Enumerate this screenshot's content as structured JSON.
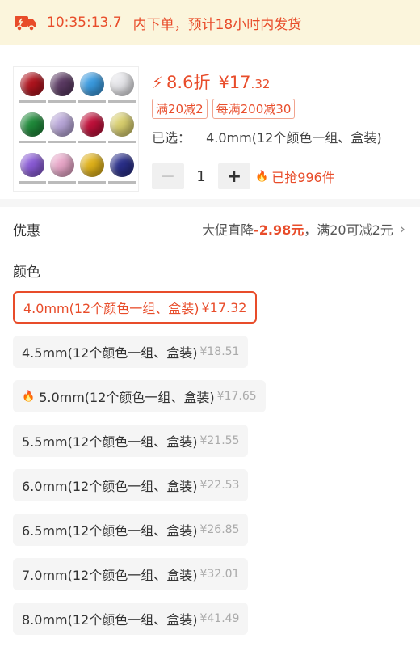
{
  "banner": {
    "icon": "delivery-truck-icon",
    "time": "10:35:13.7",
    "text": "内下单，预计18小时内发货",
    "color": "#e84c2a",
    "bg": "#fbf5dc"
  },
  "product": {
    "thumbnail": "gemstone-color-chart",
    "discount": "8.6折",
    "price_int": "¥17",
    "price_dec": ".32",
    "coupons": [
      "满20减2",
      "每满200减30"
    ],
    "selected_label": "已选：",
    "selected_value": "4.0mm(12个颜色一组、盒装)",
    "quantity": "1",
    "sold": "已抢996件"
  },
  "promo": {
    "label": "优惠",
    "prefix": "大促直降",
    "amount": "-2.98元",
    "suffix": "，满20可减2元"
  },
  "options_title": "颜色",
  "options": [
    {
      "label": "4.0mm(12个颜色一组、盒装)",
      "price": "¥17.32",
      "selected": true,
      "hot": false
    },
    {
      "label": "4.5mm(12个颜色一组、盒装)",
      "price": "¥18.51",
      "selected": false,
      "hot": false
    },
    {
      "label": "5.0mm(12个颜色一组、盒装)",
      "price": "¥17.65",
      "selected": false,
      "hot": true
    },
    {
      "label": "5.5mm(12个颜色一组、盒装)",
      "price": "¥21.55",
      "selected": false,
      "hot": false
    },
    {
      "label": "6.0mm(12个颜色一组、盒装)",
      "price": "¥22.53",
      "selected": false,
      "hot": false
    },
    {
      "label": "6.5mm(12个颜色一组、盒装)",
      "price": "¥26.85",
      "selected": false,
      "hot": false
    },
    {
      "label": "7.0mm(12个颜色一组、盒装)",
      "price": "¥32.01",
      "selected": false,
      "hot": false
    },
    {
      "label": "8.0mm(12个颜色一组、盒装)",
      "price": "¥41.49",
      "selected": false,
      "hot": false
    }
  ],
  "gem_colors": [
    "#b0141e",
    "#5b3a63",
    "#3a9be0",
    "#e6e6ea",
    "#1f8a3a",
    "#b8a6d8",
    "#c0103a",
    "#d9cf6e",
    "#8a5bd6",
    "#e8a6c8",
    "#e0b21a",
    "#2a2f8a"
  ]
}
